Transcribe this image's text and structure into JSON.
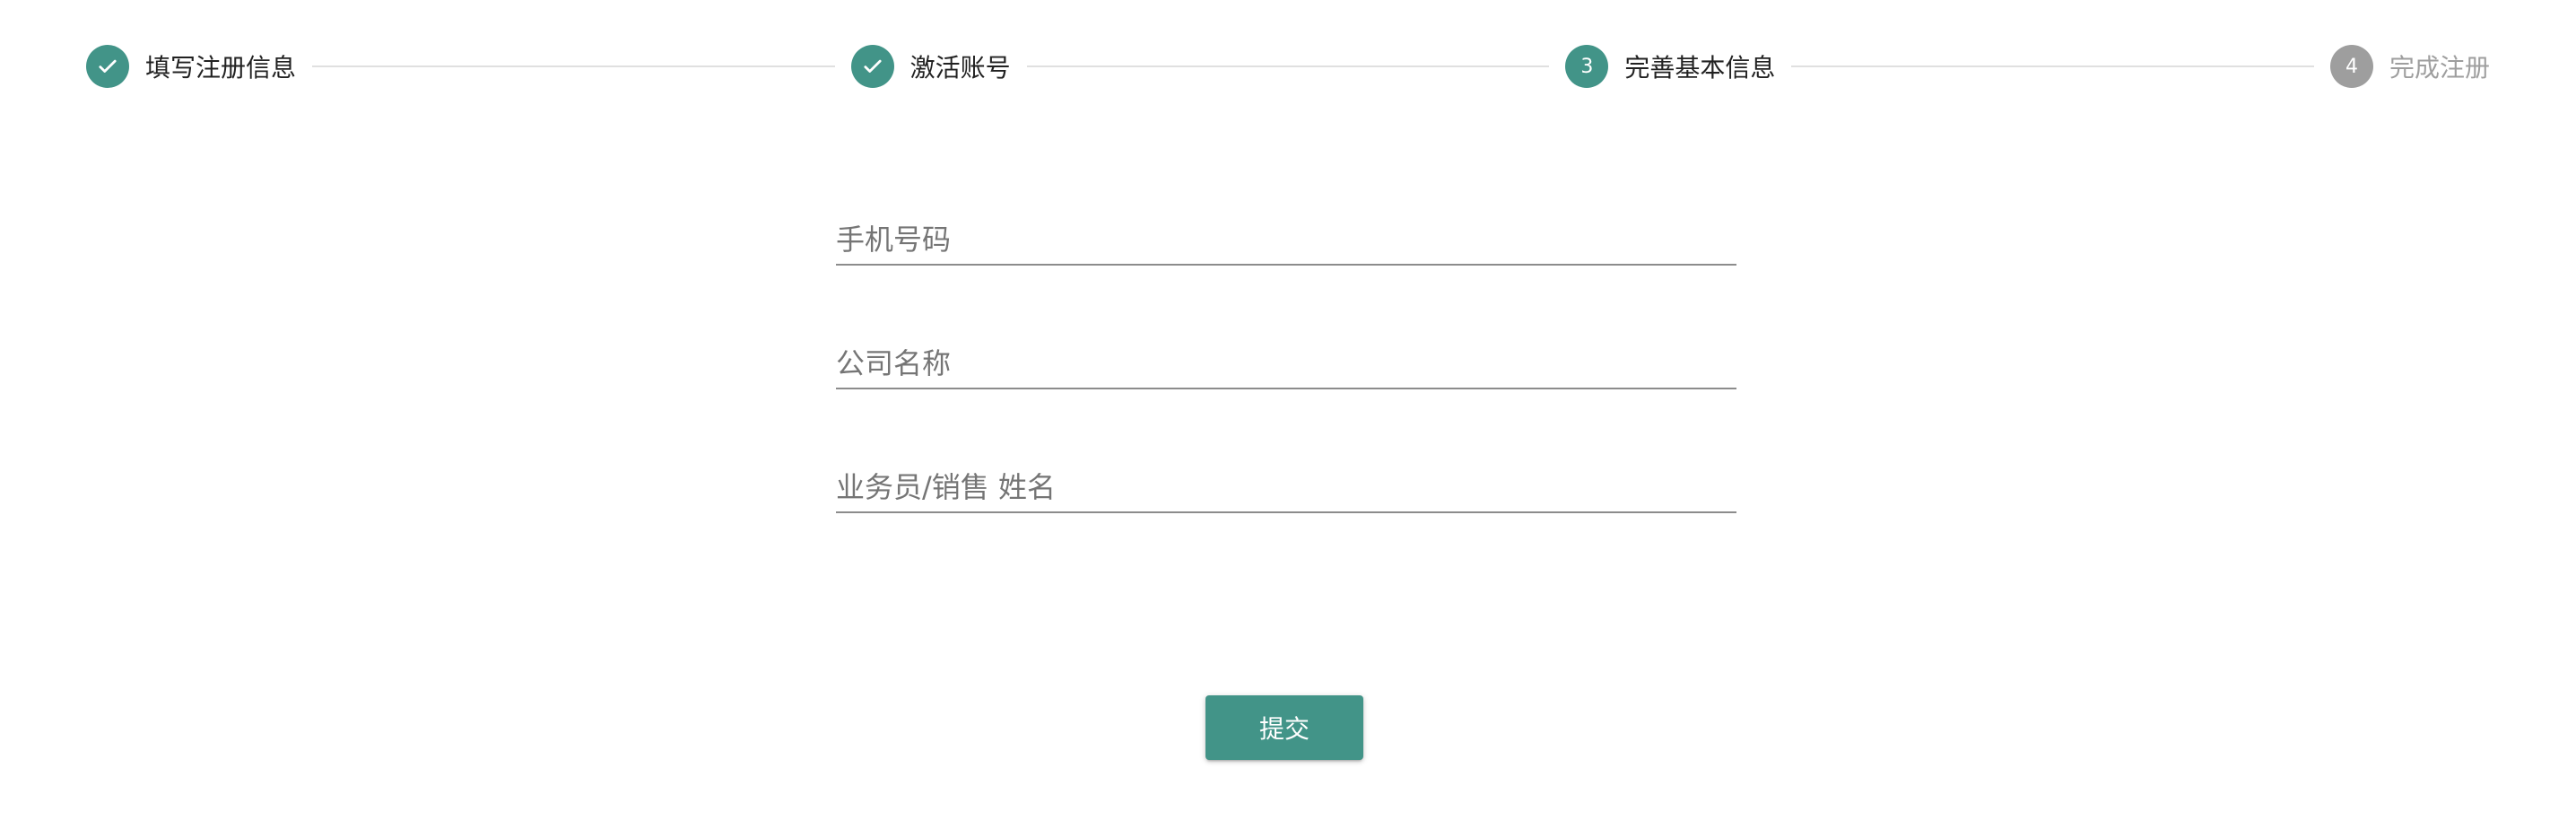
{
  "stepper": {
    "steps": [
      {
        "label": "填写注册信息",
        "state": "done",
        "number": "1",
        "icon": "check-icon"
      },
      {
        "label": "激活账号",
        "state": "done",
        "number": "2",
        "icon": "check-icon"
      },
      {
        "label": "完善基本信息",
        "state": "active",
        "number": "3"
      },
      {
        "label": "完成注册",
        "state": "pending",
        "number": "4"
      }
    ]
  },
  "form": {
    "phone": {
      "placeholder": "手机号码",
      "value": ""
    },
    "company": {
      "placeholder": "公司名称",
      "value": ""
    },
    "salesperson": {
      "placeholder": "业务员/销售 姓名",
      "value": ""
    }
  },
  "actions": {
    "submit_label": "提交"
  },
  "colors": {
    "accent": "#429488",
    "pending": "#9e9e9e",
    "connector": "#e0e0e0"
  }
}
